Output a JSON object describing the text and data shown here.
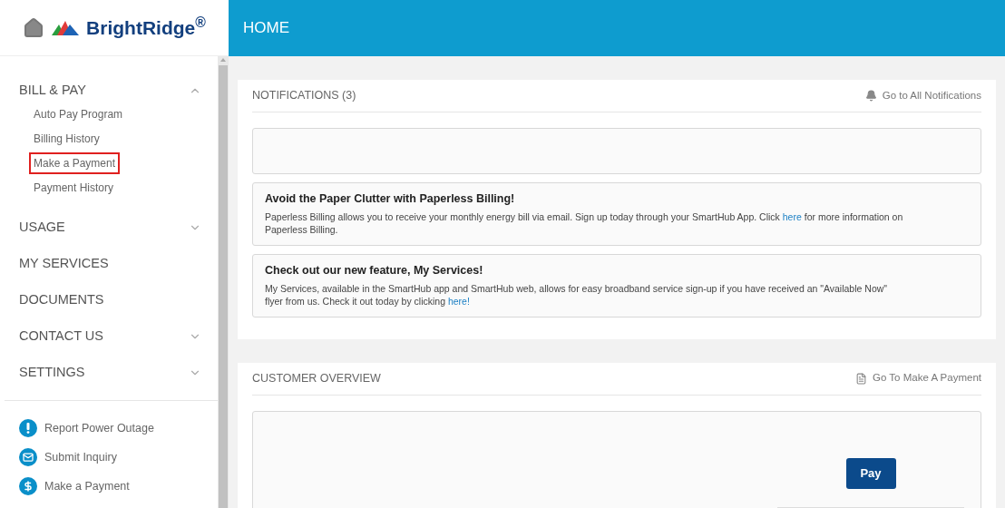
{
  "logo": {
    "brand": "BrightRidge$^{®}$"
  },
  "header": {
    "title": "HOME"
  },
  "sidebar": {
    "items": [
      {
        "label": "BILL & PAY",
        "kind": "group",
        "expanded": true,
        "children": [
          {
            "label": "Auto Pay Program",
            "highlighted": false
          },
          {
            "label": "Billing History",
            "highlighted": false
          },
          {
            "label": "Make a Payment",
            "highlighted": true
          },
          {
            "label": "Payment History",
            "highlighted": false
          }
        ]
      },
      {
        "label": "USAGE",
        "kind": "group",
        "expanded": false
      },
      {
        "label": "MY SERVICES",
        "kind": "link"
      },
      {
        "label": "DOCUMENTS",
        "kind": "link"
      },
      {
        "label": "CONTACT US",
        "kind": "group",
        "expanded": false
      },
      {
        "label": "SETTINGS",
        "kind": "group",
        "expanded": false
      }
    ],
    "quick_links": [
      {
        "label": "Report Power Outage",
        "kind": "alert"
      },
      {
        "label": "Submit Inquiry",
        "kind": "mail"
      },
      {
        "label": "Make a Payment",
        "kind": "dollar"
      }
    ]
  },
  "notifications": {
    "title": "NOTIFICATIONS (3)",
    "action": "Go to All Notifications",
    "items": [
      {
        "kind": "empty"
      },
      {
        "kind": "message",
        "title": "Avoid the Paper Clutter with Paperless Billing!",
        "text_before": "Paperless Billing allows you to receive your monthly energy bill via email. Sign up today through your SmartHub App. Click ",
        "link": "here",
        "text_after": " for more information on Paperless Billing."
      },
      {
        "kind": "message",
        "title": "Check out our new feature, My Services!",
        "text_before": "My Services, available in the SmartHub app and SmartHub web, allows for easy broadband service sign-up if you have received an \"Available Now\" flyer from us. Check it out today by clicking ",
        "link": "here!"
      }
    ]
  },
  "customer_overview": {
    "title": "CUSTOMER OVERVIEW",
    "action": "Go To Make A Payment",
    "pay_button": "Pay"
  }
}
